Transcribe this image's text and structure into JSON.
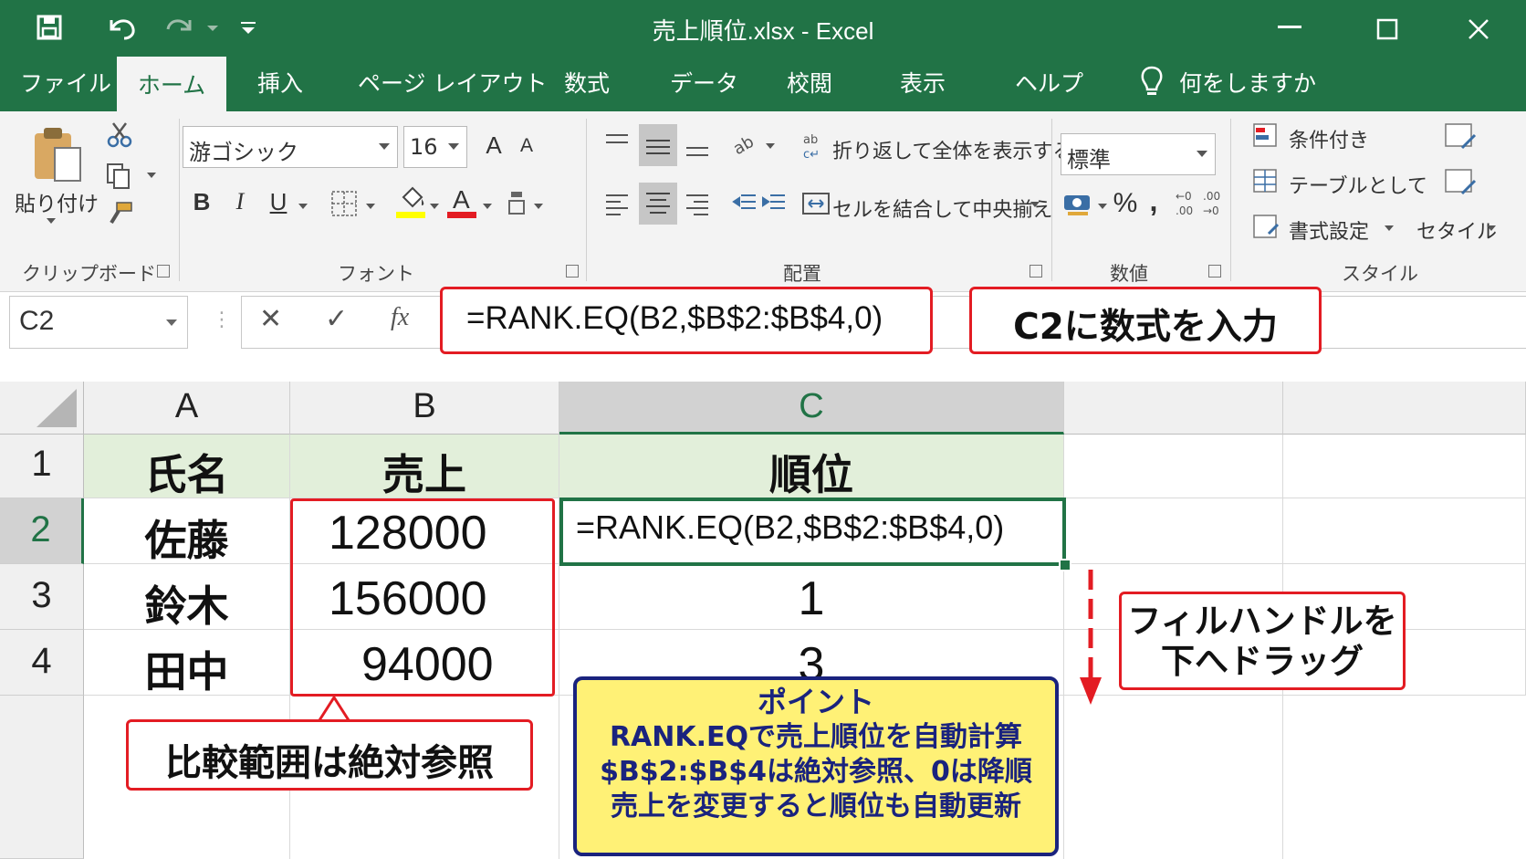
{
  "window": {
    "title": "売上順位.xlsx  -  Excel",
    "qat_icons": [
      "save-icon",
      "undo-icon",
      "redo-icon",
      "customize-qat-icon"
    ],
    "controls": [
      "minimize-icon",
      "maximize-icon",
      "close-icon"
    ]
  },
  "tabs": [
    {
      "label": "ファイル"
    },
    {
      "label": "ホーム",
      "active": true
    },
    {
      "label": "挿入"
    },
    {
      "label": "ページ レイアウト"
    },
    {
      "label": "数式"
    },
    {
      "label": "データ"
    },
    {
      "label": "校閲"
    },
    {
      "label": "表示"
    },
    {
      "label": "ヘルプ"
    }
  ],
  "tell_me": "何をしますか",
  "ribbon": {
    "clipboard": {
      "paste": "貼り付け",
      "label": "クリップボード"
    },
    "font": {
      "name": "游ゴシック",
      "size": "16",
      "label": "フォント",
      "bold": "B",
      "italic": "I",
      "underline": "U",
      "grow": "A",
      "shrink": "A"
    },
    "alignment": {
      "wrap": "折り返して全体を表示する",
      "merge": "セルを結合して中央揃え",
      "label": "配置"
    },
    "number": {
      "format": "標準",
      "percent": "%",
      "comma": ",",
      "label": "数値"
    },
    "styles": {
      "conditional": "条件付き",
      "table": "テーブルとして",
      "format": "書式設定",
      "cell": "セタイル",
      "label": "スタイル"
    }
  },
  "formula_bar": {
    "name_box": "C2",
    "cancel": "✕",
    "enter": "✓",
    "fx": "fx",
    "formula": "=RANK.EQ(B2,$B$2:$B$4,0)"
  },
  "sheet": {
    "columns": [
      "A",
      "B",
      "C"
    ],
    "rows": [
      "1",
      "2",
      "3",
      "4"
    ],
    "header": [
      "氏名",
      "売上",
      "順位"
    ],
    "data": [
      {
        "name": "佐藤",
        "sales": "128000",
        "rank": "=RANK.EQ(B2,$B$2:$B$4,0)"
      },
      {
        "name": "鈴木",
        "sales": "156000",
        "rank": "1"
      },
      {
        "name": "田中",
        "sales": "94000",
        "rank": "3"
      }
    ]
  },
  "callouts": {
    "formula_input": "C2に数式を入力",
    "fill_handle": [
      "フィルハンドルを",
      "下へドラッグ"
    ],
    "absolute_ref": "比較範囲は絶対参照",
    "point": [
      "ポイント",
      "RANK.EQで売上順位を自動計算",
      "$B$2:$B$4は絶対参照、0は降順",
      "売上を変更すると順位も自動更新"
    ]
  },
  "colors": {
    "excel_green": "#217346",
    "header_fill": "#e2efda",
    "callout_red": "#e31c23",
    "point_fill": "#fff176",
    "point_border": "#1a237e"
  }
}
